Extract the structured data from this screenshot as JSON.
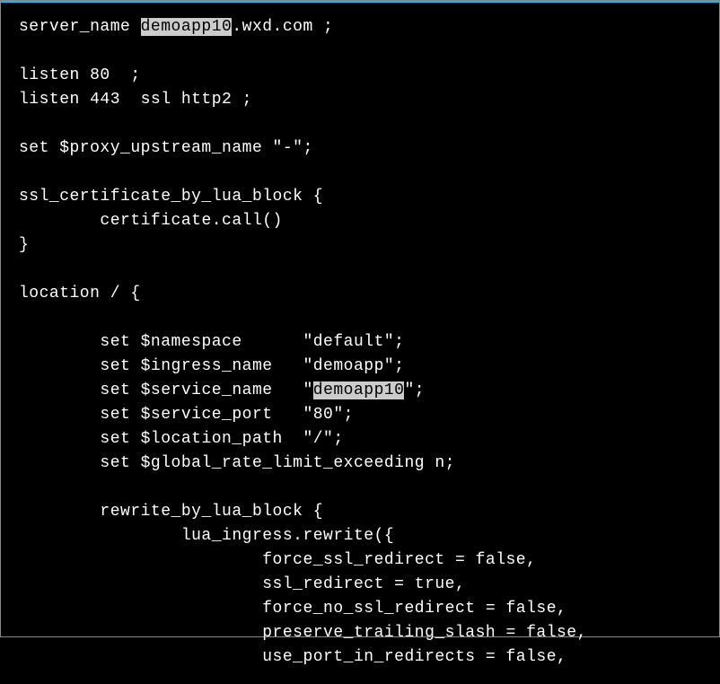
{
  "lines": [
    {
      "indent": 0,
      "segments": [
        {
          "t": "server_name "
        },
        {
          "t": "demoapp10",
          "hl": true
        },
        {
          "t": ".wxd.com ;"
        }
      ]
    },
    {
      "indent": 0,
      "segments": []
    },
    {
      "indent": 0,
      "segments": [
        {
          "t": "listen 80  ;"
        }
      ]
    },
    {
      "indent": 0,
      "segments": [
        {
          "t": "listen 443  ssl http2 ;"
        }
      ]
    },
    {
      "indent": 0,
      "segments": []
    },
    {
      "indent": 0,
      "segments": [
        {
          "t": "set $proxy_upstream_name \"-\";"
        }
      ]
    },
    {
      "indent": 0,
      "segments": []
    },
    {
      "indent": 0,
      "segments": [
        {
          "t": "ssl_certificate_by_lua_block {"
        }
      ]
    },
    {
      "indent": 8,
      "segments": [
        {
          "t": "certificate.call()"
        }
      ]
    },
    {
      "indent": 0,
      "segments": [
        {
          "t": "}"
        }
      ]
    },
    {
      "indent": 0,
      "segments": []
    },
    {
      "indent": 0,
      "segments": [
        {
          "t": "location / {"
        }
      ]
    },
    {
      "indent": 0,
      "segments": []
    },
    {
      "indent": 8,
      "segments": [
        {
          "t": "set $namespace      \"default\";"
        }
      ]
    },
    {
      "indent": 8,
      "segments": [
        {
          "t": "set $ingress_name   \"demoapp\";"
        }
      ]
    },
    {
      "indent": 8,
      "segments": [
        {
          "t": "set $service_name   \""
        },
        {
          "t": "demoapp10",
          "hl": true
        },
        {
          "t": "\";"
        }
      ]
    },
    {
      "indent": 8,
      "segments": [
        {
          "t": "set $service_port   \"80\";"
        }
      ]
    },
    {
      "indent": 8,
      "segments": [
        {
          "t": "set $location_path  \"/\";"
        }
      ]
    },
    {
      "indent": 8,
      "segments": [
        {
          "t": "set $global_rate_limit_exceeding n;"
        }
      ]
    },
    {
      "indent": 0,
      "segments": []
    },
    {
      "indent": 8,
      "segments": [
        {
          "t": "rewrite_by_lua_block {"
        }
      ]
    },
    {
      "indent": 16,
      "segments": [
        {
          "t": "lua_ingress.rewrite({"
        }
      ]
    },
    {
      "indent": 24,
      "segments": [
        {
          "t": "force_ssl_redirect = false,"
        }
      ]
    },
    {
      "indent": 24,
      "segments": [
        {
          "t": "ssl_redirect = true,"
        }
      ]
    },
    {
      "indent": 24,
      "segments": [
        {
          "t": "force_no_ssl_redirect = false,"
        }
      ]
    },
    {
      "indent": 24,
      "segments": [
        {
          "t": "preserve_trailing_slash = false,"
        }
      ]
    },
    {
      "indent": 24,
      "segments": [
        {
          "t": "use_port_in_redirects = false,"
        }
      ]
    }
  ]
}
